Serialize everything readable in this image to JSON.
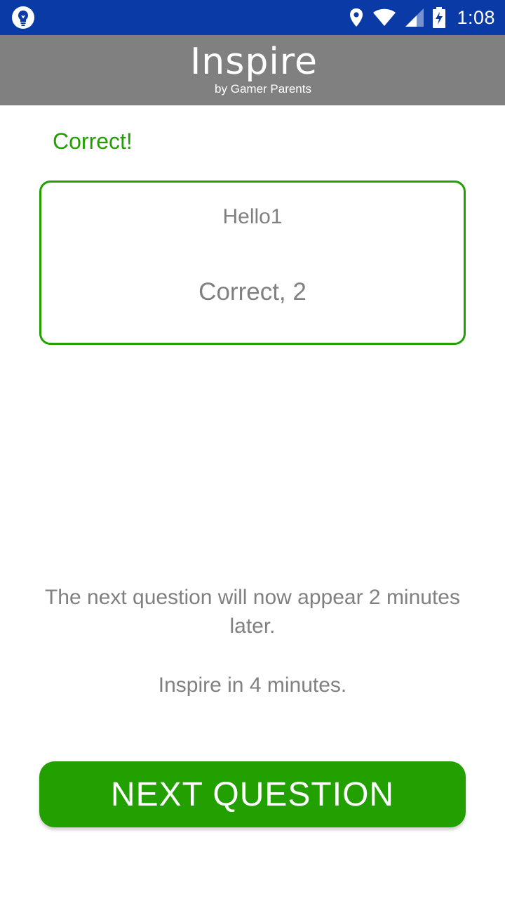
{
  "status_bar": {
    "time": "1:08",
    "icons": [
      "lightbulb-icon",
      "location-icon",
      "wifi-icon",
      "signal-icon",
      "battery-charging-icon"
    ],
    "color": "#0a3aa6"
  },
  "header": {
    "logo_title": "Inspire",
    "logo_subtitle": "by Gamer Parents",
    "color": "#808080"
  },
  "result": {
    "label": "Correct!",
    "color": "#21a000"
  },
  "card": {
    "question": "Hello1",
    "answer": "Correct, 2"
  },
  "info": {
    "next_message": "The next question will now appear 2 minutes later.",
    "timer_message": "Inspire in 4 minutes."
  },
  "actions": {
    "next_label": "NEXT QUESTION",
    "color": "#21a000"
  }
}
